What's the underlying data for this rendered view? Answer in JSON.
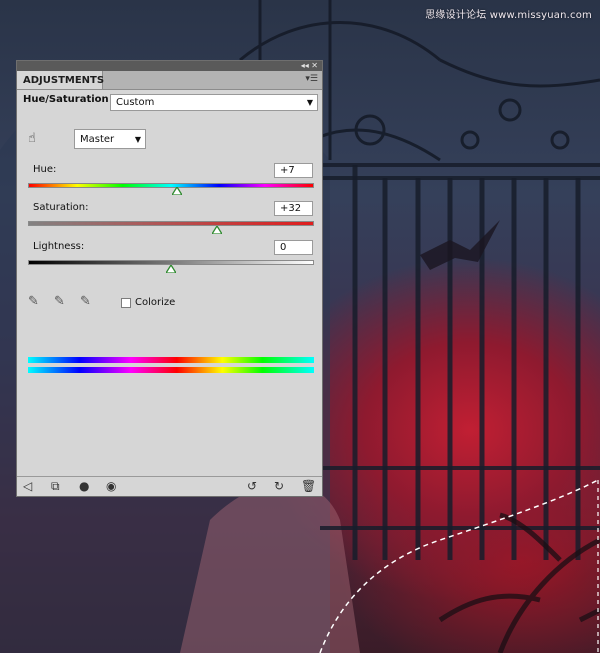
{
  "watermark": "思缘设计论坛 www.missyuan.com",
  "panel": {
    "tab_label": "ADJUSTMENTS",
    "title": "Hue/Saturation",
    "preset": {
      "value": "Custom"
    },
    "channel": {
      "value": "Master"
    },
    "sliders": [
      {
        "label": "Hue:",
        "value": "+7",
        "min": -180,
        "max": 180,
        "current": 7
      },
      {
        "label": "Saturation:",
        "value": "+32",
        "min": -100,
        "max": 100,
        "current": 32
      },
      {
        "label": "Lightness:",
        "value": "0",
        "min": -100,
        "max": 100,
        "current": 0
      }
    ],
    "colorize": {
      "label": "Colorize",
      "checked": false
    }
  },
  "colors": {
    "panel_bg": "#d6d6d6",
    "thumb": "#2f8a2f"
  },
  "icons": {
    "targeted_adjust": "hand-icon",
    "eyedroppers": [
      "eyedropper-icon",
      "eyedropper-add-icon",
      "eyedropper-subtract-icon"
    ],
    "footer": [
      "back-arrow-icon",
      "clip-layer-icon",
      "mask-icon",
      "visibility-eye-icon",
      "previous-state-icon",
      "reset-icon",
      "trash-icon"
    ]
  }
}
